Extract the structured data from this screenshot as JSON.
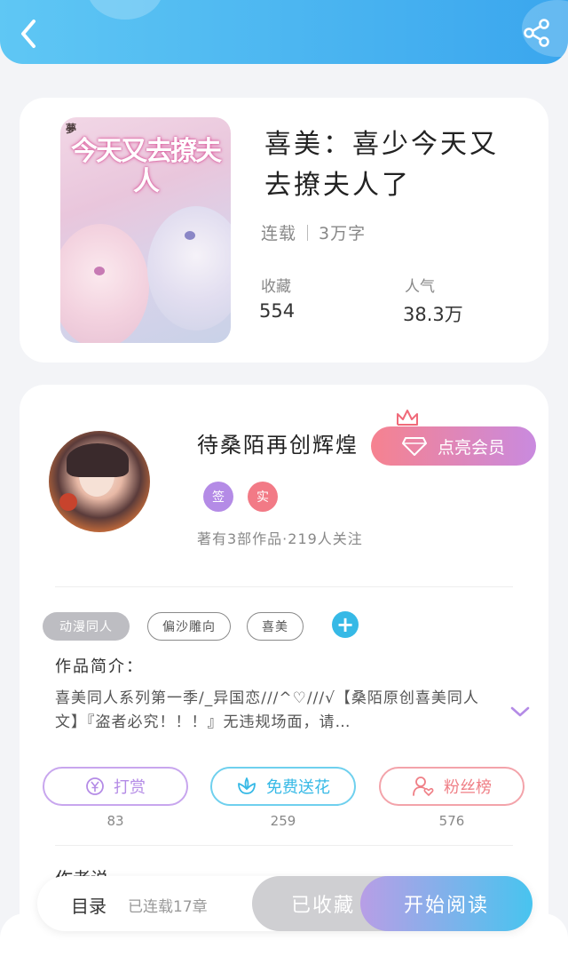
{
  "header": {
    "back_icon": "back-arrow-icon",
    "share_icon": "share-icon"
  },
  "book": {
    "cover_title": "今天又去撩夫人",
    "cover_mark": "夢",
    "title": "喜美：喜少今天又去撩夫人了",
    "status": "连载",
    "word_count": "3万字",
    "stats": [
      {
        "label": "收藏",
        "value": "554"
      },
      {
        "label": "人气",
        "value": "38.3万"
      }
    ]
  },
  "author": {
    "name": "待桑陌再创辉煌",
    "vip_label": "点亮会员",
    "badges": [
      {
        "label": "签",
        "color": "#b48be6"
      },
      {
        "label": "实",
        "color": "#f27a86"
      }
    ],
    "works_summary": "著有3部作品·219人关注"
  },
  "tags": [
    "动漫同人",
    "偏沙雕向",
    "喜美"
  ],
  "intro": {
    "label": "作品简介：",
    "text": "喜美同人系列第一季/_异国恋///^♡///√【桑陌原创喜美同人文】『盗者必究！！！』无违规场面，请…"
  },
  "actions": [
    {
      "label": "打赏",
      "count": "83",
      "icon": "yen-coin-icon",
      "color": "#b48be6"
    },
    {
      "label": "免费送花",
      "count": "259",
      "icon": "flower-icon",
      "color": "#36b9e6"
    },
    {
      "label": "粉丝榜",
      "count": "576",
      "icon": "user-heart-icon",
      "color": "#ef7f86"
    }
  ],
  "section_peek": "作者说",
  "bottom_bar": {
    "catalog_label": "目录",
    "chapters_label": "已连载17章",
    "favorited_label": "已收藏",
    "read_label": "开始阅读"
  },
  "colors": {
    "accent_blue": "#3aa6ee",
    "vip_pink": "#f6828f",
    "vip_purple": "#c98adf"
  }
}
